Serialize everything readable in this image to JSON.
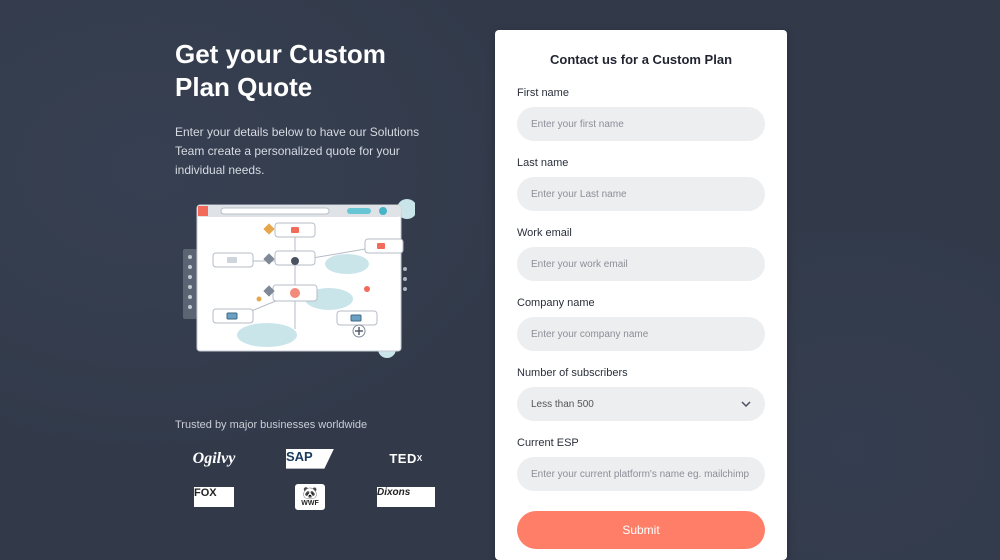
{
  "hero": {
    "title": "Get your Custom Plan Quote",
    "description": "Enter your details below to have our Solutions Team create a personalized quote for your individual needs.",
    "trusted_label": "Trusted by major businesses worldwide"
  },
  "logos": {
    "ogilvy": "Ogilvy",
    "sap": "SAP",
    "tedx": "TED",
    "tedx_sup": "X",
    "fox": "FOX",
    "wwf": "WWF",
    "dixons": "Dixons"
  },
  "form": {
    "heading": "Contact us for a Custom Plan",
    "first_name": {
      "label": "First name",
      "placeholder": "Enter your first name"
    },
    "last_name": {
      "label": "Last name",
      "placeholder": "Enter your Last name"
    },
    "email": {
      "label": "Work email",
      "placeholder": "Enter your work email"
    },
    "company": {
      "label": "Company name",
      "placeholder": "Enter your company name"
    },
    "subscribers": {
      "label": "Number of subscribers",
      "selected": "Less than 500"
    },
    "esp": {
      "label": "Current ESP",
      "placeholder": "Enter your current platform's name eg. mailchimp"
    },
    "submit": "Submit"
  },
  "colors": {
    "bg": "#323a4a",
    "accent": "#ff7e67",
    "input_bg": "#eceef0"
  }
}
